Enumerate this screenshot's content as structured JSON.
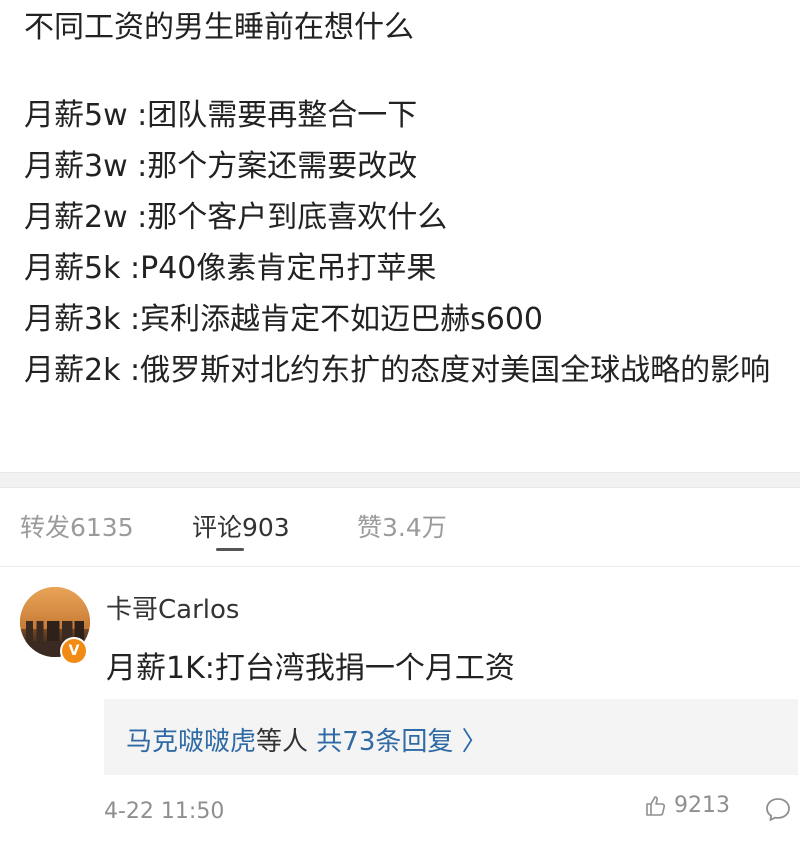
{
  "post": {
    "title": "不同工资的男生睡前在想什么",
    "lines": [
      "月薪5w :团队需要再整合一下",
      "月薪3w :那个方案还需要改改",
      "月薪2w :那个客户到底喜欢什么",
      "月薪5k :P40像素肯定吊打苹果",
      "月薪3k :宾利添越肯定不如迈巴赫s600",
      "月薪2k :俄罗斯对北约东扩的态度对美国全球战略的影响"
    ]
  },
  "tabs": {
    "repost": "转发6135",
    "comments": "评论903",
    "likes": "赞3.4万"
  },
  "comment": {
    "username": "卡哥Carlos",
    "verified_badge": "V",
    "text": "月薪1K:打台湾我捐一个月工资",
    "reply_user": "马克啵啵虎",
    "reply_mid": "等人",
    "reply_count": "共73条回复",
    "reply_chevron": "〉",
    "time": "4-22 11:50",
    "like_count": "9213",
    "like_icon": "thumbs-up-icon",
    "reply_icon": "speech-bubble-icon",
    "badge_color": "#f28a16",
    "link_color": "#2f6aa5"
  }
}
